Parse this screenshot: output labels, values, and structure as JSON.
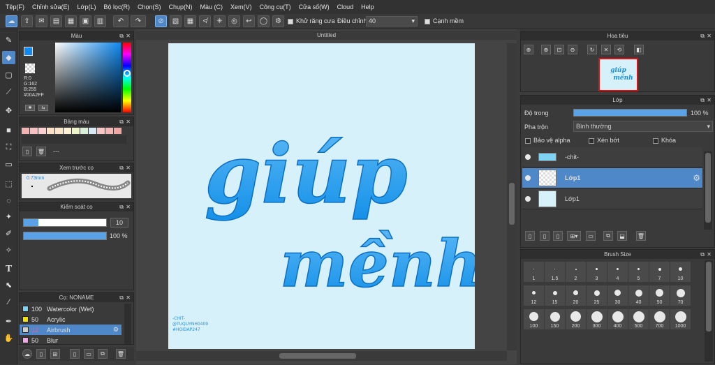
{
  "menu": [
    "Tệp(F)",
    "Chỉnh sửa(E)",
    "Lớp(L)",
    "Bộ lọc(R)",
    "Chọn(S)",
    "Chụp(N)",
    "Màu (C)",
    "Xem(V)",
    "Công cụ(T)",
    "Cửa số(W)",
    "Cloud",
    "Help"
  ],
  "toolbar": {
    "antialias": "Khử răng cưa",
    "adjust": "Điều chỉnh",
    "adjust_value": "40",
    "smooth": "Cạnh mềm"
  },
  "color_panel": {
    "title": "Màu",
    "r": "R:0",
    "g": "G:162",
    "b": "B:255",
    "hex": "#00A2FF",
    "fg": "#0f8af0",
    "bg": "#111111"
  },
  "palette_panel": {
    "title": "Bảng màu",
    "colors": [
      "#f4b3b3",
      "#f6c0c0",
      "#fbd0d0",
      "#fde0c4",
      "#fbe6c8",
      "#fdf2d4",
      "#eef6c8",
      "#d8efd8",
      "#d6e9f4",
      "#f7c6c6",
      "#f4b7b7",
      "#f1a6a6"
    ],
    "dash": "---"
  },
  "preview_panel": {
    "title": "Xem trước cọ",
    "size": "0.73mm"
  },
  "brush_control": {
    "title": "Kiểm soát cọ",
    "size": "10",
    "opacity": "100 %"
  },
  "brush_panel": {
    "title": "Cọ: NONAME",
    "items": [
      {
        "n": "100",
        "name": "Watercolor (Wet)",
        "c": "#7fd3f2"
      },
      {
        "n": "50",
        "name": "Acrylic",
        "c": "#f2e000"
      },
      {
        "n": "12",
        "name": "Airbrush",
        "c": "#cfcfcf"
      },
      {
        "n": "50",
        "name": "Blur",
        "c": "#f2a8e8"
      }
    ]
  },
  "canvas": {
    "tab": "Untitled",
    "text1": "giúp",
    "text2": "mềnh",
    "sig1": "-CHIT-",
    "sig2": "@TUQUYNH0409",
    "sig3": "#HOIDAP247"
  },
  "navigator": {
    "title": "Hoa tiêu"
  },
  "layer_panel": {
    "title": "Lớp",
    "opacity_label": "Độ trong",
    "opacity_value": "100 %",
    "blend_label": "Pha trộn",
    "blend_value": "Bình thường",
    "protect_alpha": "Bảo vệ alpha",
    "clip": "Xén bớt",
    "lock": "Khóa",
    "layers": [
      "-chit-",
      "Lớp1",
      "Lớp1"
    ]
  },
  "brush_size_panel": {
    "title": "Brush Size",
    "sizes": [
      "1",
      "1.5",
      "2",
      "3",
      "4",
      "5",
      "7",
      "10",
      "12",
      "15",
      "20",
      "25",
      "30",
      "40",
      "50",
      "70",
      "100",
      "150",
      "200",
      "300",
      "400",
      "500",
      "700",
      "1000"
    ]
  }
}
